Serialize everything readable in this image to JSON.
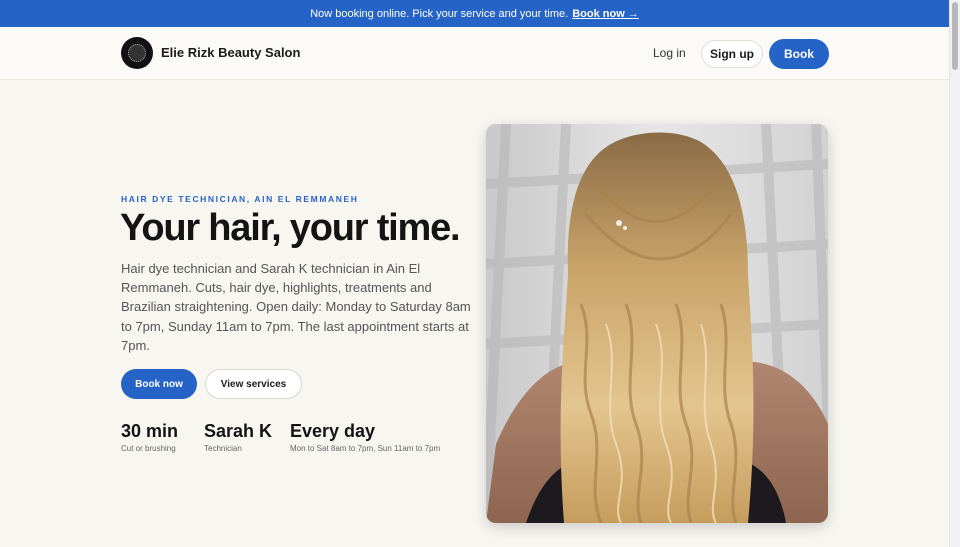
{
  "announcement": {
    "text": "Now booking online. Pick your service and your time.",
    "link": "Book now →"
  },
  "header": {
    "brand": "Elie Rizk Beauty Salon",
    "login": "Log in",
    "signup": "Sign up",
    "book": "Book"
  },
  "hero": {
    "eyebrow": "HAIR DYE TECHNICIAN, AIN EL REMMANEH",
    "title": "Your hair, your time.",
    "description": "Hair dye technician and Sarah K technician in Ain El Remmaneh. Cuts, hair dye, highlights, treatments and Brazilian straightening. Open daily: Monday to Saturday 8am to 7pm, Sunday 11am to 7pm. The last appointment starts at 7pm.",
    "primary_cta": "Book now",
    "secondary_cta": "View services",
    "stats": [
      {
        "value": "30 min",
        "label": "Cut or brushing"
      },
      {
        "value": "Sarah K",
        "label": "Technician"
      },
      {
        "value": "Every day",
        "label": "Mon to Sat 8am to 7pm, Sun 11am to 7pm"
      }
    ]
  },
  "colors": {
    "accent": "#2563c7",
    "background": "#f8f6f1"
  }
}
